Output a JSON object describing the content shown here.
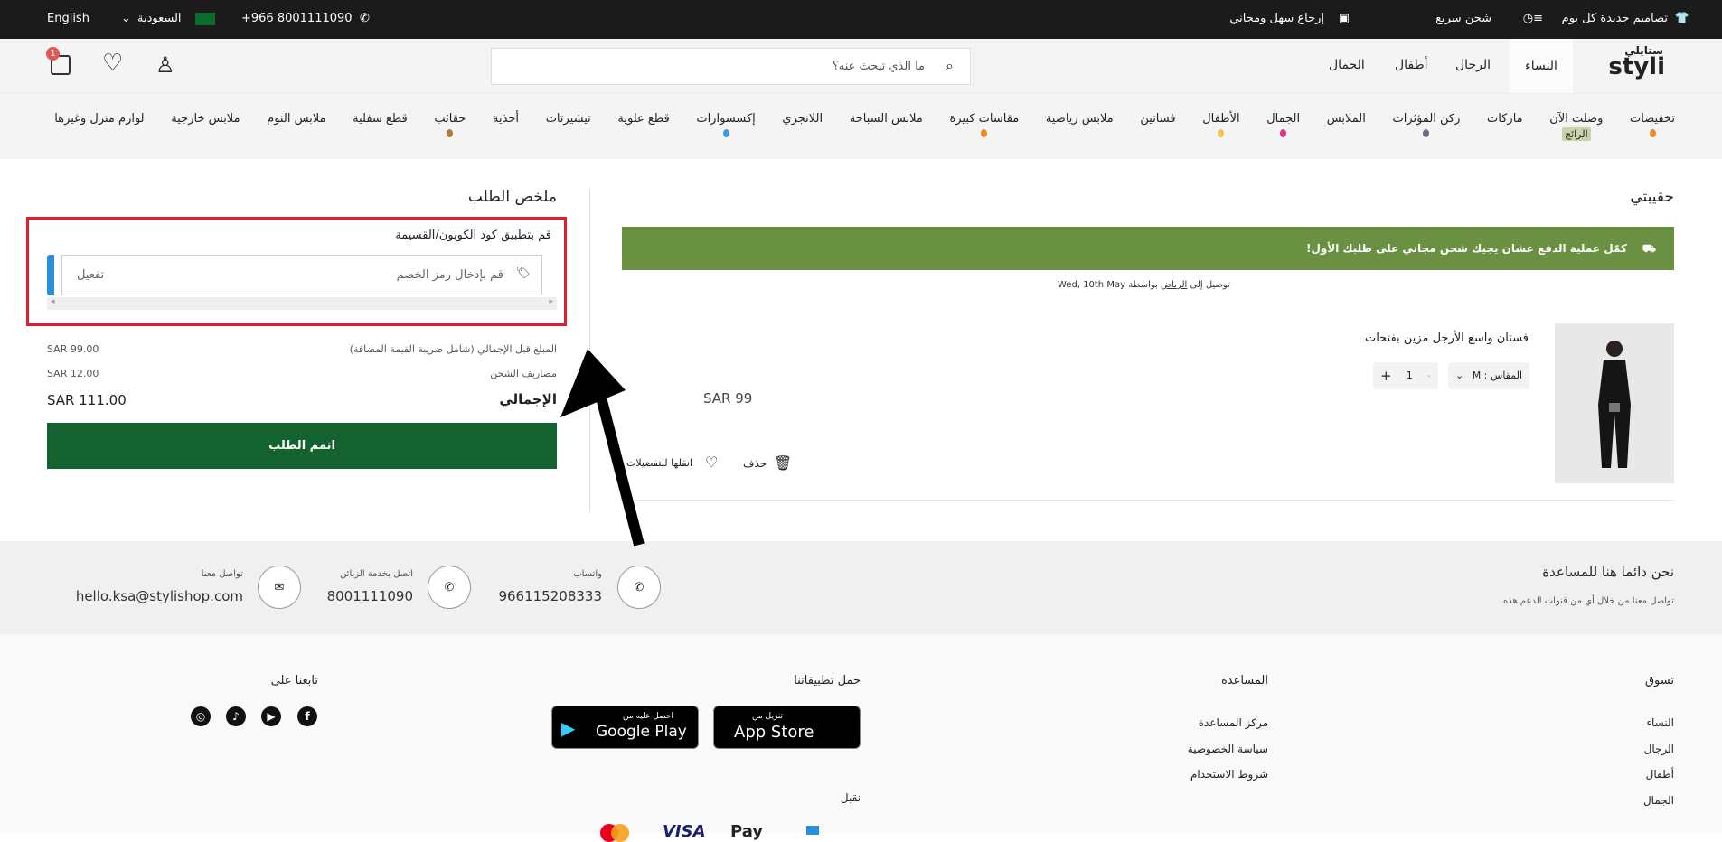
{
  "topbar": {
    "language": "English",
    "country": "السعودية",
    "phone": "+966 8001111090",
    "perks": [
      "تصاميم جديدة كل يوم",
      "شحن سريع",
      "إرجاع سهل ومجاني"
    ]
  },
  "header": {
    "logo_ar": "ستايلي",
    "logo": "styli",
    "tabs": [
      "النساء",
      "الرجال",
      "أطفال",
      "الجمال"
    ],
    "active_tab": "النساء",
    "search_placeholder": "ما الذي تبحث عنه؟",
    "cart_count": "1"
  },
  "nav": {
    "items": [
      {
        "label": "تخفيضات",
        "mark": "#f08a24"
      },
      {
        "label": "وصلت الآن",
        "badge": "الرائج"
      },
      {
        "label": "ماركات"
      },
      {
        "label": "ركن المؤثرات",
        "mark": "#6b6b8a"
      },
      {
        "label": "الملابس"
      },
      {
        "label": "الجمال",
        "mark": "#e0338a"
      },
      {
        "label": "الأطفال",
        "mark": "#f3c34a"
      },
      {
        "label": "فساتين"
      },
      {
        "label": "ملابس رياضية"
      },
      {
        "label": "مقاسات كبيرة",
        "mark": "#f08a24"
      },
      {
        "label": "ملابس السباحة"
      },
      {
        "label": "اللانجري"
      },
      {
        "label": "إكسسوارات",
        "mark": "#3a9be0"
      },
      {
        "label": "قطع علوية"
      },
      {
        "label": "تيشيرتات"
      },
      {
        "label": "أحذية"
      },
      {
        "label": "حقائب",
        "mark": "#b07a3a"
      },
      {
        "label": "قطع سفلية"
      },
      {
        "label": "ملابس النوم"
      },
      {
        "label": "ملابس خارجية"
      },
      {
        "label": "لوازم منزل وغيرها"
      }
    ]
  },
  "summary": {
    "title": "ملخص الطلب",
    "coupon_label": "قم بتطبيق كود الكوبون/القسيمة",
    "coupon_placeholder": "قم بإدخال رمز الخصم",
    "apply": "تفعيل",
    "subtotal_label": "المبلغ قبل الإجمالي (شامل ضريبة القيمة المضافة)",
    "subtotal": "SAR 99.00",
    "shipping_label": "مصاريف الشحن",
    "shipping": "SAR 12.00",
    "total_label": "الإجمالي",
    "total": "SAR 111.00",
    "checkout": "اتمم الطلب"
  },
  "bag": {
    "title": "حقيبتي",
    "banner": "كمّل عملية الدفع عشان يجيك شحن مجاني على طلبك الأول!",
    "delivery_prefix": "توصيل إلى",
    "delivery_city": "الرياض",
    "delivery_by": "بواسطة",
    "delivery_date": "Wed, 10th May",
    "item": {
      "name": "فستان واسع الأرجل مزين بفتحات",
      "size_label": "المقاس : M",
      "qty": "1",
      "price": "SAR 99",
      "delete": "حذف",
      "move_wishlist": "انقلها للتفضيلات"
    }
  },
  "contact": {
    "title": "نحن دائما هنا للمساعدة",
    "subtitle": "تواصل معنا من خلال أي من قنوات الدعم هذه",
    "whatsapp_label": "واتساب",
    "whatsapp": "966115208333",
    "phone_label": "اتصل بخدمة الزبائن",
    "phone": "8001111090",
    "email_label": "تواصل معنا",
    "email": "hello.ksa@stylishop.com"
  },
  "footer": {
    "shop_title": "تسوق",
    "shop_links": [
      "النساء",
      "الرجال",
      "أطفال",
      "الجمال"
    ],
    "help_title": "المساعدة",
    "help_links": [
      "مركز المساعدة",
      "سياسة الخصوصية",
      "شروط الاستخدام"
    ],
    "apps_title": "حمل تطبيقاتنا",
    "appstore_small": "تنزيل من",
    "appstore": "App Store",
    "gplay_small": "احصل عليه من",
    "gplay": "Google Play",
    "follow_title": "تابعنا على",
    "accept_title": "نقبل",
    "payments": [
      "mastercard",
      "VISA",
      "Pay",
      "mada"
    ]
  },
  "colors": {
    "checkout": "#14622f",
    "banner": "#6a9142",
    "highlight": "#e31b2c"
  }
}
